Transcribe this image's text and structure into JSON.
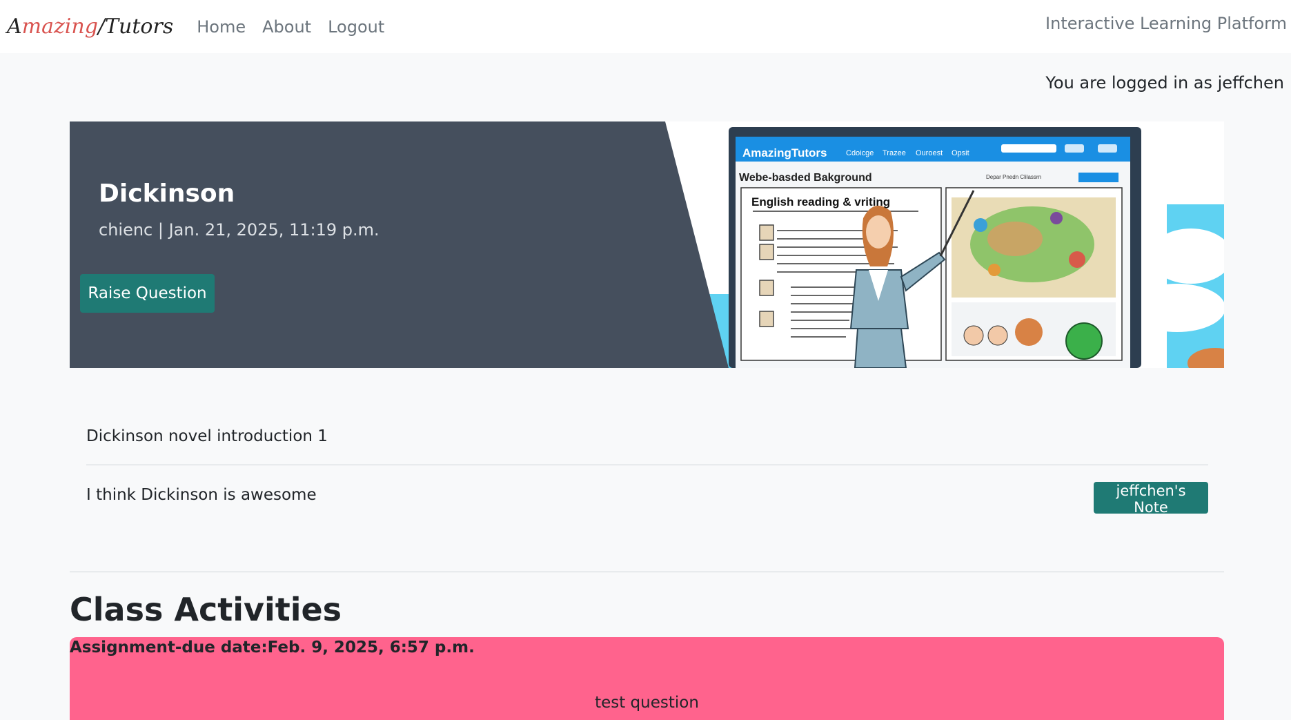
{
  "navbar": {
    "brand_pre": "A",
    "brand_accent": "mazing",
    "brand_post": "/Tutors",
    "links": [
      "Home",
      "About",
      "Logout"
    ],
    "tagline": "Interactive Learning Platform"
  },
  "login_status": "You are logged in as jeffchen",
  "hero": {
    "title": "Dickinson",
    "meta": "chienc | Jan. 21, 2025, 11:19 p.m.",
    "raise_button": "Raise Question",
    "illustration": {
      "brand": "AmazingTutors",
      "menu": [
        "Cdoicge",
        "Trazee",
        "Ouroest",
        "Opsit"
      ],
      "panel_title": "Webe-basded Bakground",
      "panel_right": "Depar Pnedn Clilassrn",
      "subject": "English   reading & vriting"
    }
  },
  "items": [
    {
      "text": "Dickinson novel introduction 1"
    },
    {
      "text": "I think Dickinson is awesome",
      "button": "jeffchen's Note"
    }
  ],
  "activities": {
    "title": "Class Activities",
    "card": {
      "heading": "Assignment-due date:Feb. 9, 2025, 6:57 p.m.",
      "question": "test question"
    }
  },
  "colors": {
    "hero_dark": "#454f5d",
    "button_teal": "#1f7a74",
    "activity_pink": "#ff638d"
  }
}
